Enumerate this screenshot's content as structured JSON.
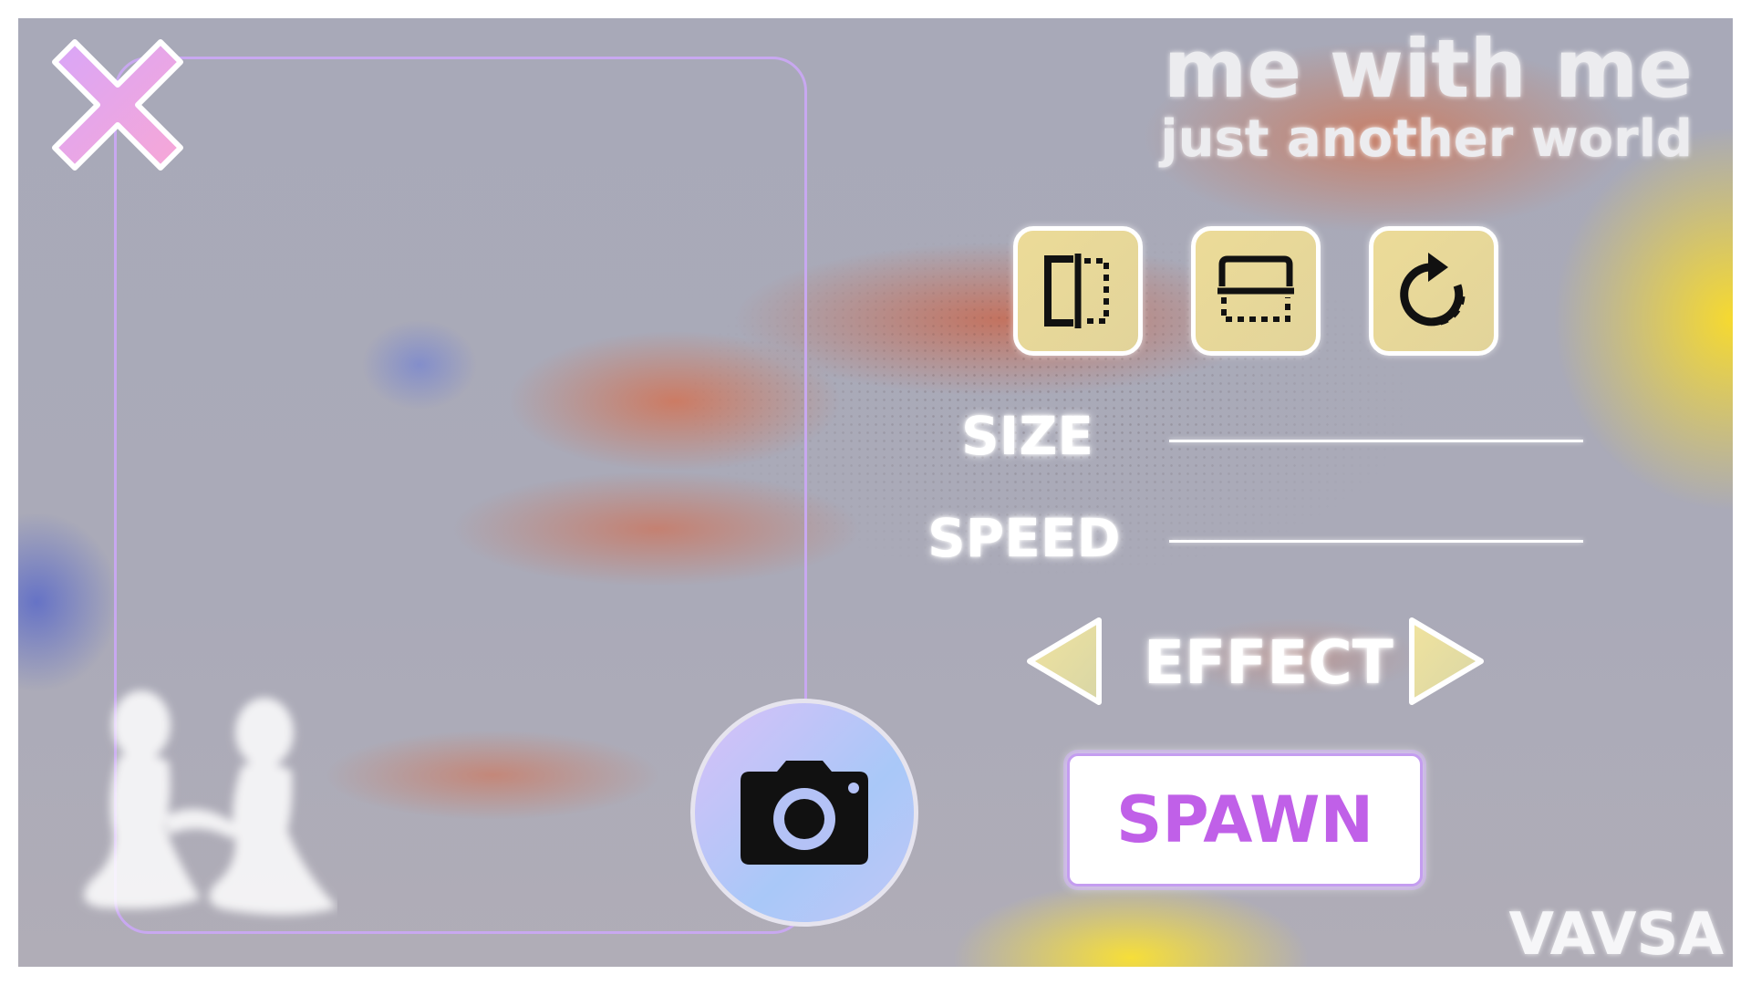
{
  "title": {
    "line1": "me with me",
    "line2": "just another world"
  },
  "toolbar": [
    {
      "icon": "flip-horizontal-icon"
    },
    {
      "icon": "flip-vertical-icon"
    },
    {
      "icon": "rotate-icon"
    }
  ],
  "controls": {
    "size_label": "SIZE",
    "speed_label": "SPEED"
  },
  "effect": {
    "label": "EFFECT",
    "prev_icon": "triangle-left-icon",
    "next_icon": "triangle-right-icon"
  },
  "spawn_label": "SPAWN",
  "camera_icon": "camera-icon",
  "close_icon": "close-x-icon",
  "watermark": "VAVSA",
  "colors": {
    "accent_purple": "#c060e8",
    "button_fill": "#e8d99a",
    "frame_border": "#c8a8f0"
  }
}
